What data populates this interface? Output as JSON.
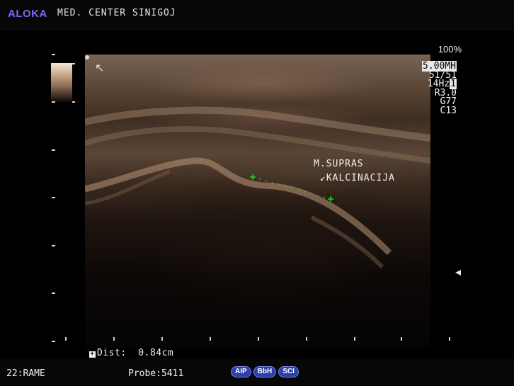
{
  "header": {
    "brand": "ALOKA",
    "institution": "MED. CENTER SINIGOJ"
  },
  "scan": {
    "power": "100%",
    "frequency": "5.00MH",
    "frame_rate_label": "51/51",
    "frame_hz_prefix": "14Hz",
    "frame_hz_box": "1",
    "resolution": "R3.0",
    "gain": "G77",
    "contrast": "C13",
    "annotation_line1": "M.SUPRAS",
    "annotation_line2": "↙KALCINACIJA",
    "orientation_marker": "↖"
  },
  "measurement": {
    "marker": "+",
    "text": "Dist:  0.84cm",
    "caliper_color": "#22dd22"
  },
  "footer": {
    "frame": "22:RAME",
    "probe": "Probe:5411",
    "modes": [
      "AIP",
      "BbH",
      "SCI"
    ]
  },
  "colors": {
    "brand": "#7b68ee",
    "mode_pill": "#2d3fa8"
  }
}
